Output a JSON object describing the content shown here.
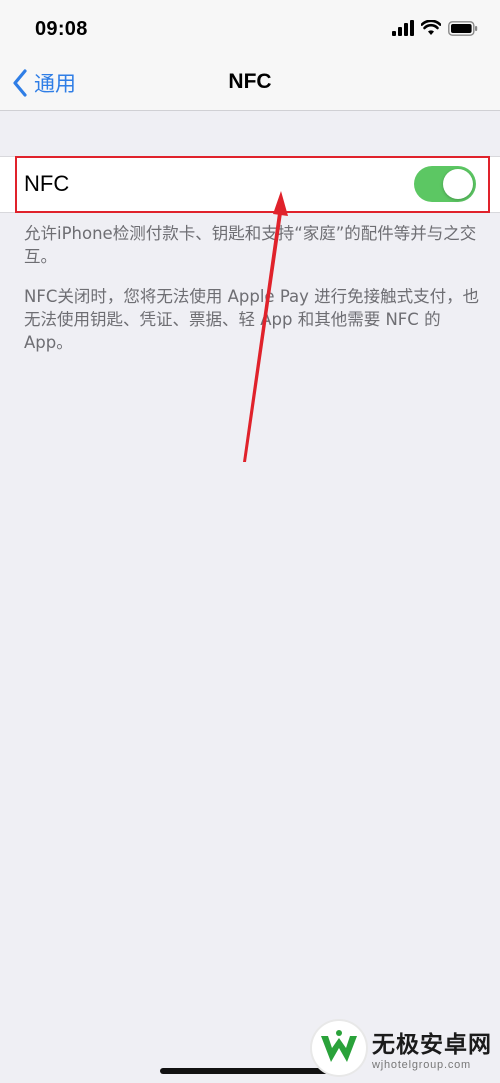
{
  "status_bar": {
    "time": "09:08",
    "icons": [
      "cellular-signal-icon",
      "wifi-icon",
      "battery-icon"
    ]
  },
  "nav": {
    "back_label": "通用",
    "title": "NFC"
  },
  "nfc_cell": {
    "label": "NFC",
    "toggle_on": true
  },
  "descriptions": [
    "允许iPhone检测付款卡、钥匙和支持“家庭”的配件等并与之交互。",
    "NFC关闭时，您将无法使用 Apple Pay 进行免接触式支付，也无法使用钥匙、凭证、票据、轻 App 和其他需要 NFC 的 App。"
  ],
  "colors": {
    "accent_blue": "#2f7ee6",
    "toggle_green": "#5cc763",
    "highlight_red": "#e0222b",
    "background": "#efeff4"
  },
  "watermark": {
    "title": "无极安卓网",
    "url": "wjhotelgroup.com"
  }
}
